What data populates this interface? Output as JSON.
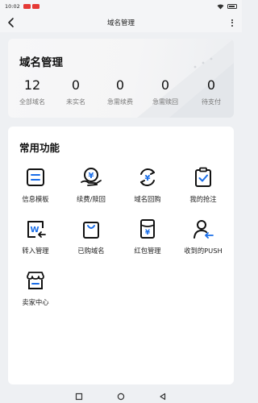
{
  "status_bar": {
    "time": "10:02"
  },
  "nav": {
    "title": "域名管理"
  },
  "overview": {
    "title": "域名管理",
    "stats": [
      {
        "value": "12",
        "label": "全部域名"
      },
      {
        "value": "0",
        "label": "未实名"
      },
      {
        "value": "0",
        "label": "急需续费"
      },
      {
        "value": "0",
        "label": "急需赎回"
      },
      {
        "value": "0",
        "label": "待支付"
      }
    ]
  },
  "functions": {
    "title": "常用功能",
    "items": [
      {
        "label": "信息模板",
        "icon": "template-icon"
      },
      {
        "label": "续费/赎回",
        "icon": "renew-icon"
      },
      {
        "label": "域名回购",
        "icon": "buyback-icon"
      },
      {
        "label": "我的抢注",
        "icon": "clipboard-check-icon"
      },
      {
        "label": "转入管理",
        "icon": "transfer-in-icon"
      },
      {
        "label": "已购域名",
        "icon": "shopping-bag-icon"
      },
      {
        "label": "红包管理",
        "icon": "red-packet-icon"
      },
      {
        "label": "收到的PUSH",
        "icon": "user-push-icon"
      },
      {
        "label": "卖家中心",
        "icon": "store-icon"
      }
    ]
  },
  "colors": {
    "accent": "#1a6ee8",
    "text": "#111111",
    "muted": "#777777"
  }
}
